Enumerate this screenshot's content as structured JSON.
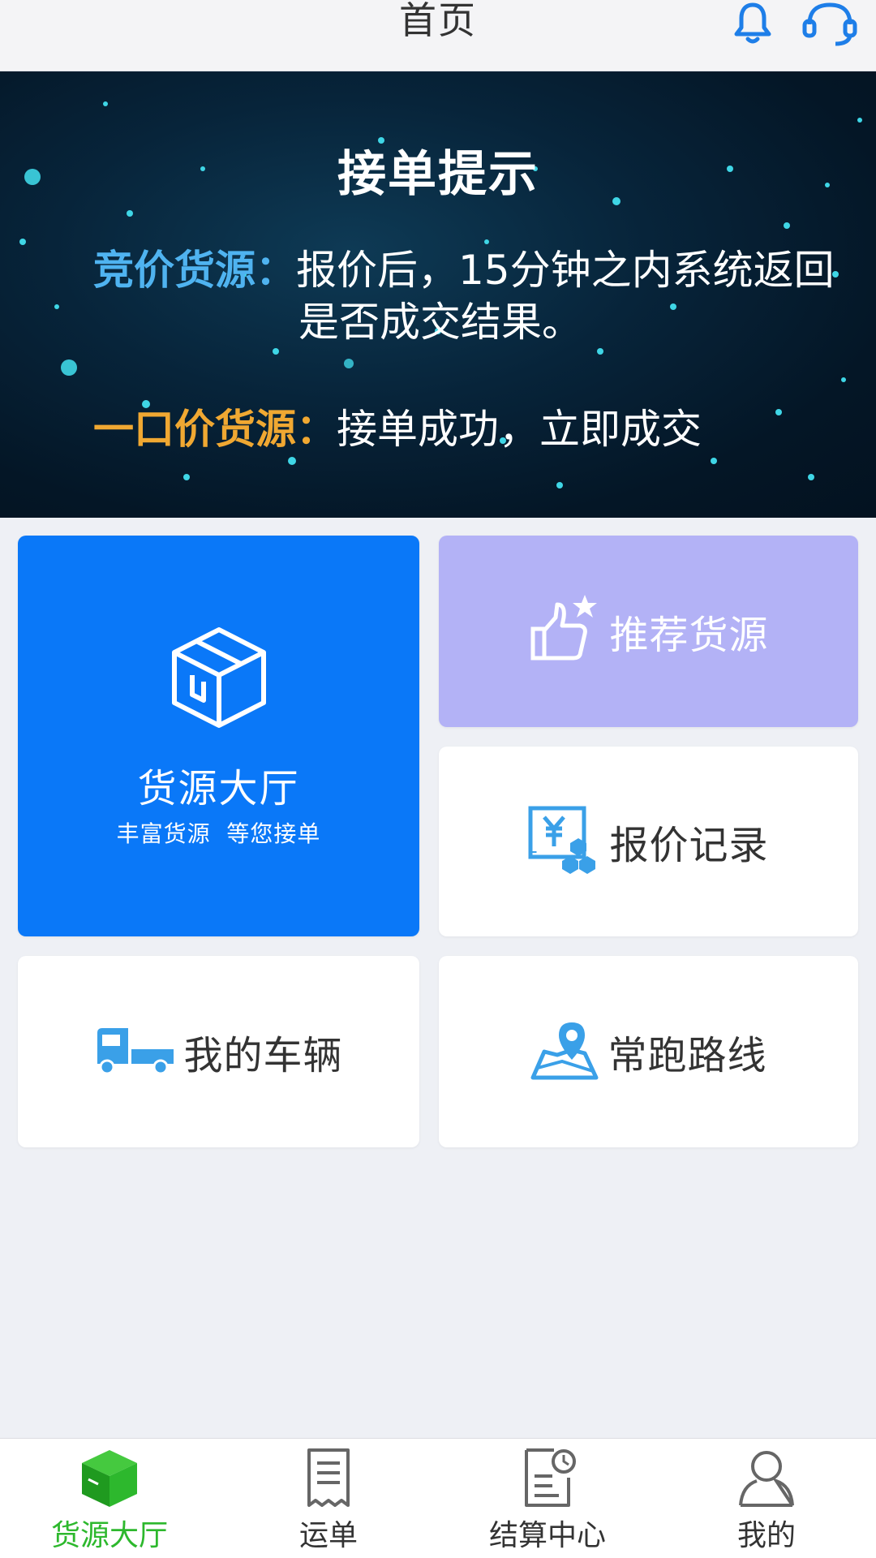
{
  "header": {
    "title": "首页",
    "bell_icon": "bell-icon",
    "support_icon": "headset-icon",
    "accent": "#1e7ee8"
  },
  "banner": {
    "title": "接单提示",
    "bid_label": "竞价货源：",
    "bid_text_line1": "报价后，15分钟之内系统返回",
    "bid_text_line2": "是否成交结果。",
    "fixed_label": "一口价货源：",
    "fixed_text": "接单成功，立即成交"
  },
  "cards": {
    "hall_title": "货源大厅",
    "hall_subtitle": "丰富货源  等您接单",
    "recommend_label": "推荐货源",
    "quote_label": "报价记录",
    "vehicle_label": "我的车辆",
    "route_label": "常跑路线"
  },
  "tabs": [
    {
      "label": "货源大厅",
      "icon": "box-icon",
      "active": true
    },
    {
      "label": "运单",
      "icon": "receipt-icon",
      "active": false
    },
    {
      "label": "结算中心",
      "icon": "settlement-icon",
      "active": false
    },
    {
      "label": "我的",
      "icon": "user-icon",
      "active": false
    }
  ],
  "colors": {
    "hall_card": "#0a78f8",
    "recommend_card": "#b3b2f6",
    "icon_blue": "#3aa0e8",
    "tab_active": "#2db82d"
  }
}
